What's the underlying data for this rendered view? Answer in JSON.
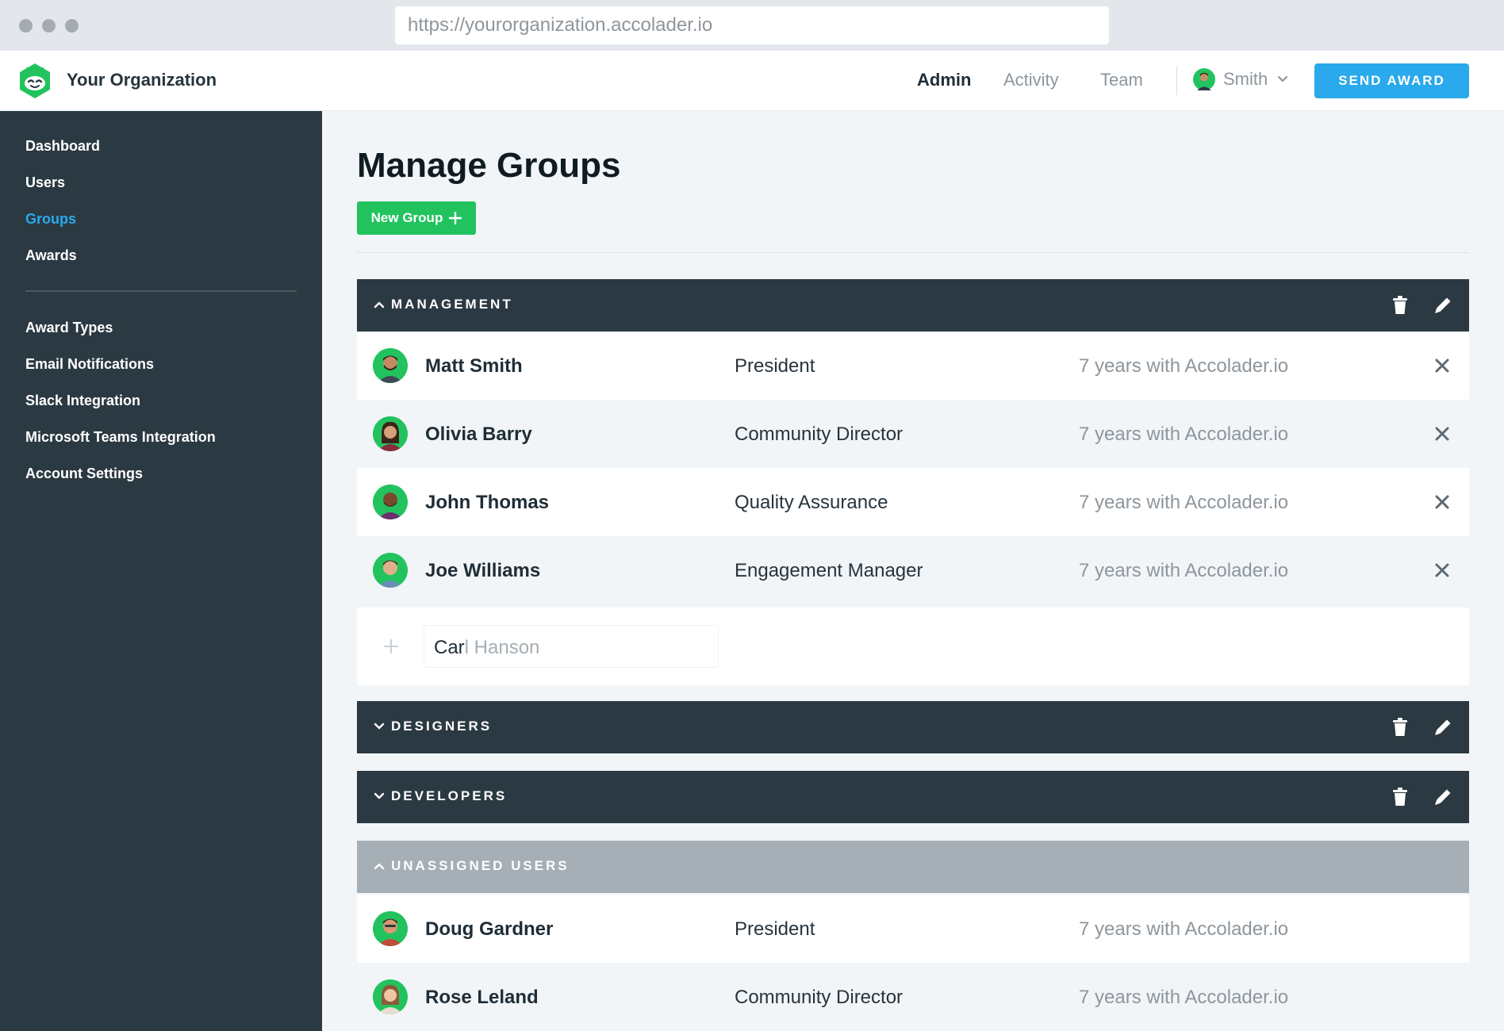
{
  "browser": {
    "url": "https://yourorganization.accolader.io"
  },
  "header": {
    "org_name": "Your Organization",
    "nav": [
      {
        "label": "Admin",
        "active": true
      },
      {
        "label": "Activity",
        "active": false
      },
      {
        "label": "Team",
        "active": false
      }
    ],
    "user_name": "Smith",
    "send_award_label": "SEND AWARD"
  },
  "sidebar": {
    "primary": [
      {
        "label": "Dashboard",
        "active": false
      },
      {
        "label": "Users",
        "active": false
      },
      {
        "label": "Groups",
        "active": true
      },
      {
        "label": "Awards",
        "active": false
      }
    ],
    "secondary": [
      {
        "label": "Award Types"
      },
      {
        "label": "Email Notifications"
      },
      {
        "label": "Slack Integration"
      },
      {
        "label": "Microsoft Teams Integration"
      },
      {
        "label": "Account Settings"
      }
    ]
  },
  "main": {
    "title": "Manage Groups",
    "new_group_label": "New Group",
    "groups": [
      {
        "name": "MANAGEMENT",
        "expanded": true,
        "members": [
          {
            "name": "Matt Smith",
            "role": "President",
            "tenure": "7 years with Accolader.io"
          },
          {
            "name": "Olivia Barry",
            "role": "Community Director",
            "tenure": "7 years with Accolader.io"
          },
          {
            "name": "John Thomas",
            "role": "Quality Assurance",
            "tenure": "7 years with Accolader.io"
          },
          {
            "name": "Joe Williams",
            "role": "Engagement Manager",
            "tenure": "7 years with Accolader.io"
          }
        ],
        "add_member": {
          "typed": "Car",
          "suggestion": "l Hanson"
        }
      },
      {
        "name": "DESIGNERS",
        "expanded": false
      },
      {
        "name": "DEVELOPERS",
        "expanded": false
      }
    ],
    "unassigned": {
      "name": "UNASSIGNED USERS",
      "expanded": true,
      "members": [
        {
          "name": "Doug Gardner",
          "role": "President",
          "tenure": "7 years with Accolader.io"
        },
        {
          "name": "Rose Leland",
          "role": "Community Director",
          "tenure": "7 years with Accolader.io"
        }
      ]
    }
  },
  "colors": {
    "accent_blue": "#2aa9ec",
    "accent_green": "#22c35e",
    "sidebar_bg": "#2b3942",
    "group_header_bg": "#2b3942",
    "unassigned_header_bg": "#a5afb5"
  },
  "icons": [
    "logo-icon",
    "chevron-down-icon",
    "chevron-up-icon",
    "trash-icon",
    "pencil-icon",
    "close-icon",
    "plus-icon",
    "avatar"
  ]
}
